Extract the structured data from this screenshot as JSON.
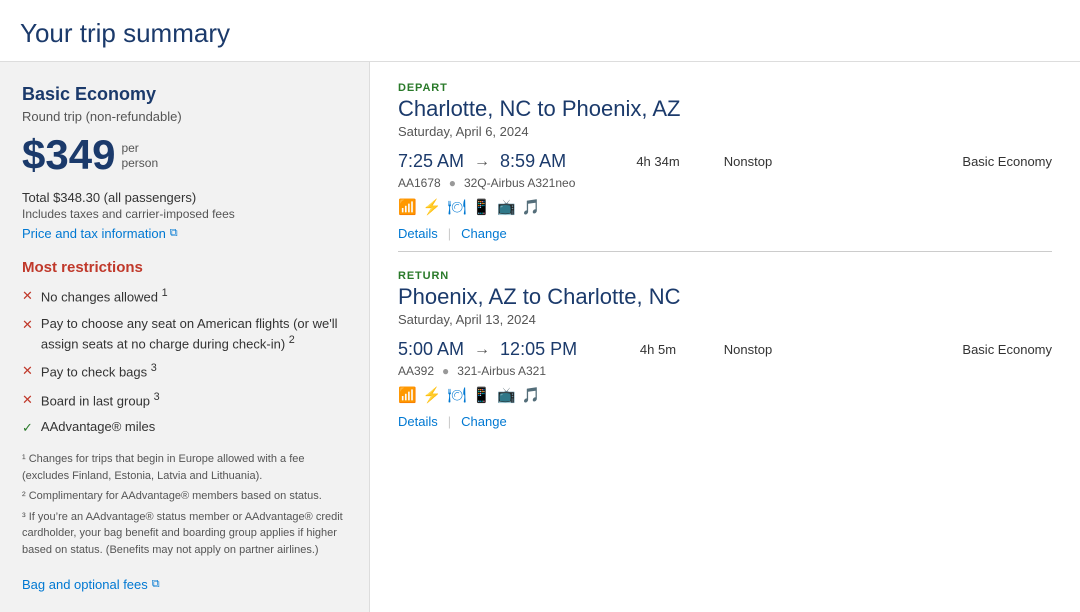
{
  "page": {
    "title": "Your trip summary"
  },
  "left": {
    "fare_title": "Basic Economy",
    "round_trip_label": "Round trip (non-refundable)",
    "price_amount": "$349",
    "price_per_line1": "per",
    "price_per_line2": "person",
    "total_label": "Total $348.30 (all passengers)",
    "includes_label": "Includes taxes and carrier-imposed fees",
    "price_link_label": "Price and tax information",
    "restrictions_title": "Most restrictions",
    "restrictions": [
      {
        "type": "x",
        "text": "No changes allowed",
        "superscript": "1"
      },
      {
        "type": "x",
        "text": "Pay to choose any seat on American flights (or we’ll assign seats at no charge during check-in)",
        "superscript": "2"
      },
      {
        "type": "x",
        "text": "Pay to check bags",
        "superscript": "3"
      },
      {
        "type": "x",
        "text": "Board in last group",
        "superscript": "3"
      },
      {
        "type": "check",
        "text": "AAdvantage® miles",
        "superscript": ""
      }
    ],
    "footnote1": "¹ Changes for trips that begin in Europe allowed with a fee (excludes Finland, Estonia, Latvia and Lithuania).",
    "footnote2": "² Complimentary for AAdvantage® members based on status.",
    "footnote3": "³ If you’re an AAdvantage® status member or AAdvantage® credit cardholder, your bag benefit and boarding group applies if higher based on status. (Benefits may not apply on partner airlines.)",
    "bag_link_label": "Bag and optional fees"
  },
  "right": {
    "depart": {
      "direction_label": "DEPART",
      "route": "Charlotte, NC to Phoenix, AZ",
      "date": "Saturday, April 6, 2024",
      "depart_time": "7:25 AM",
      "arrive_time": "8:59 AM",
      "duration": "4h 34m",
      "nonstop": "Nonstop",
      "fare_class": "Basic Economy",
      "flight_number": "AA1678",
      "aircraft": "32Q-Airbus A321neo",
      "details_label": "Details",
      "change_label": "Change"
    },
    "return": {
      "direction_label": "RETURN",
      "route": "Phoenix, AZ to Charlotte, NC",
      "date": "Saturday, April 13, 2024",
      "depart_time": "5:00 AM",
      "arrive_time": "12:05 PM",
      "duration": "4h 5m",
      "nonstop": "Nonstop",
      "fare_class": "Basic Economy",
      "flight_number": "AA392",
      "aircraft": "321-Airbus A321",
      "details_label": "Details",
      "change_label": "Change"
    }
  }
}
